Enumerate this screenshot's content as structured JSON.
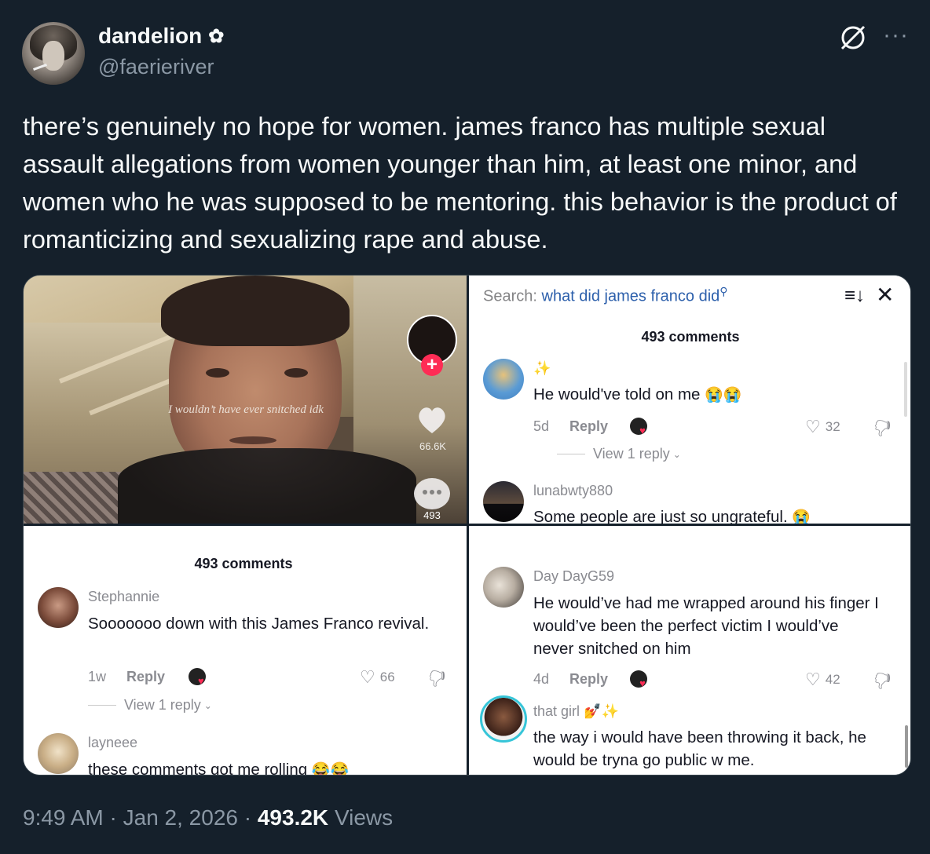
{
  "author": {
    "display_name": "dandelion",
    "badge": "✿",
    "handle": "@faerieriver"
  },
  "tweet": {
    "text": "there’s genuinely no hope for women. james franco has multiple sexual assault allegations from women younger than him, at least one minor, and women who he was supposed to be mentoring. this behavior is the product of romanticizing and sexualizing rape and abuse."
  },
  "icons": {
    "grok": "grok-icon",
    "more": "more-icon"
  },
  "video_frame": {
    "overlay_text": "I wouldn’t have ever snitched idk",
    "follow_plus": "+",
    "like_count": "66.6K",
    "comment_count": "493"
  },
  "tile_search": {
    "label": "Search:",
    "query": "what did james franco did",
    "comments_count": "493 comments",
    "comments": [
      {
        "user": "",
        "sparkle": "✨",
        "text": "He would've told on me",
        "emoji": "😭😭",
        "age": "5d",
        "reply": "Reply",
        "likes": "32",
        "view_replies": "View 1 reply"
      },
      {
        "user": "lunabwty880",
        "text": "Some people are just so ungrateful.",
        "emoji": "😭"
      }
    ]
  },
  "tile_stephannie": {
    "comments_count": "493 comments",
    "comments": [
      {
        "user": "Stephannie",
        "text": "Sooooooo down with this James Franco revival.",
        "age": "1w",
        "reply": "Reply",
        "likes": "66",
        "view_replies": "View 1 reply"
      },
      {
        "user": "layneee",
        "text": "these comments got me rolling",
        "emoji": "😂😂"
      }
    ]
  },
  "tile_day": {
    "comments": [
      {
        "user": "Day DayG59",
        "text": "He would’ve had me wrapped around his finger I would’ve been the perfect victim I would’ve never snitched on him",
        "age": "4d",
        "reply": "Reply",
        "likes": "42"
      },
      {
        "user": "that girl",
        "user_emoji": "💅✨",
        "text": "the way i would have been throwing it back, he would be tryna go public w me."
      }
    ]
  },
  "footer": {
    "time": "9:49 AM",
    "sep1": "·",
    "date": "Jan 2, 2026",
    "sep2": "·",
    "views_count": "493.2K",
    "views_label": "Views"
  },
  "colors": {
    "background": "#15202b",
    "text": "#f7f9f9",
    "muted": "#8b98a5",
    "tiktok_red": "#fe2c55",
    "search_blue": "#2c5fab"
  }
}
